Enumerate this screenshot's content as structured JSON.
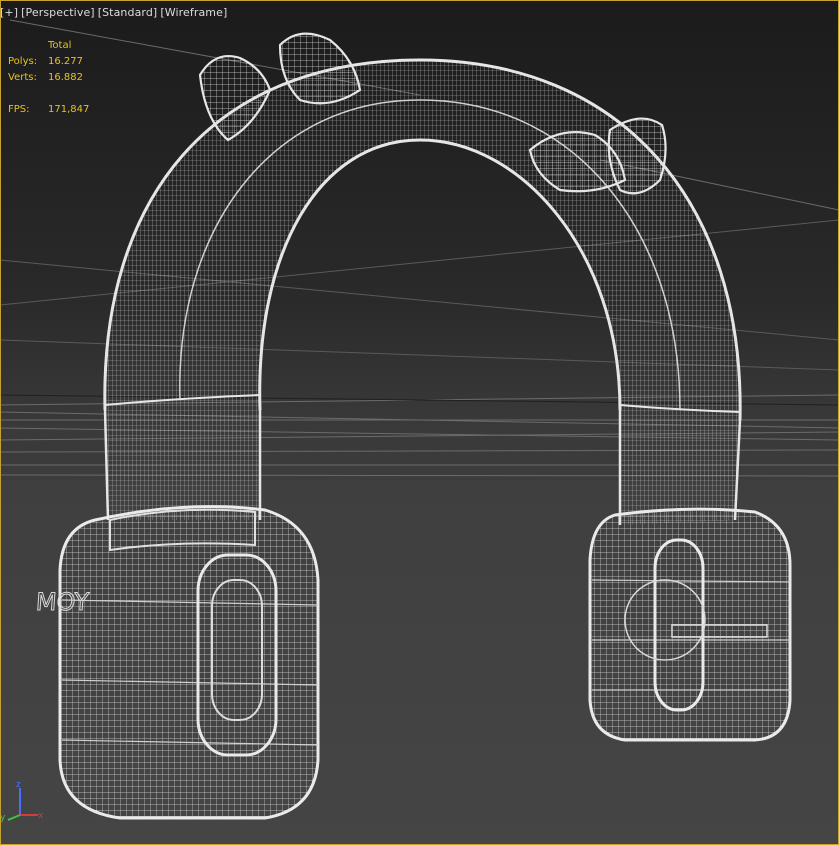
{
  "viewport_labels": {
    "plus": "[+]",
    "view": "[Perspective]",
    "shading": "[Standard]",
    "mode": "[Wireframe]"
  },
  "stats": {
    "header": "Total",
    "polys_label": "Polys:",
    "polys_value": "16.277",
    "verts_label": "Verts:",
    "verts_value": "16.882",
    "fps_label": "FPS:",
    "fps_value": "171,847"
  },
  "axis_gizmo": {
    "x": "x",
    "y": "y",
    "z": "z"
  },
  "colors": {
    "stats_text": "#e6c31c",
    "wire": "#e0e0e0",
    "active_border": "#c8a22a",
    "axis_x": "#d23c3c",
    "axis_y": "#3cc83c",
    "axis_z": "#4a6cff"
  },
  "icons": [
    "axis-gizmo-icon",
    "headphones-wireframe-model"
  ]
}
